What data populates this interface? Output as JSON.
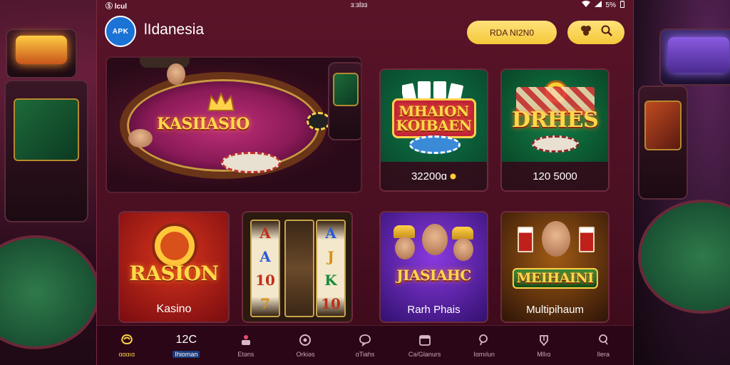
{
  "status": {
    "time_left": "Ⓢ lcul",
    "time_center": "ɜ:ɜlɜɜ",
    "battery": "5%"
  },
  "header": {
    "logo_text": "APK",
    "brand": "lIdanesia",
    "wallet_label": "RDA NI2N0",
    "search_icon": "search-icon",
    "chips_icon": "chips-icon"
  },
  "feature": {
    "title": "KASIIASIO",
    "emblem": "crown-icon"
  },
  "games": [
    {
      "title": "MHAION KOIBAEN",
      "footer": "32200ɑ",
      "footer_icon": "coin-icon"
    },
    {
      "title": "DRHES",
      "footer": "120 5000"
    },
    {
      "title": "RASION",
      "footer": "Kasino"
    },
    {
      "title": "slot-reels",
      "reels": [
        [
          "A",
          "A",
          "10",
          "7"
        ],
        [
          "",
          "",
          "",
          ""
        ],
        [
          "A",
          "J",
          "K",
          "10"
        ]
      ]
    },
    {
      "title": "JIASIAHC",
      "footer": "Rarh Phais"
    },
    {
      "title": "MEIHAINI",
      "footer": "Multipihaum"
    }
  ],
  "bottom_nav": [
    {
      "icon": "home-icon",
      "label": "ɑɑɑıɑ",
      "active": true
    },
    {
      "text": "12C",
      "label": "Ihioman",
      "highlight": true
    },
    {
      "icon": "cake-icon",
      "label": "Etəns"
    },
    {
      "icon": "target-icon",
      "label": "Orkiəs"
    },
    {
      "icon": "chat-icon",
      "label": "ɑTiahs"
    },
    {
      "icon": "calendar-icon",
      "label": "Cə/Glanurs"
    },
    {
      "icon": "search-icon",
      "label": "Iɑmılun"
    },
    {
      "icon": "gift-icon",
      "label": "Mllıɑ"
    },
    {
      "icon": "user-icon",
      "label": "Ilera"
    }
  ]
}
